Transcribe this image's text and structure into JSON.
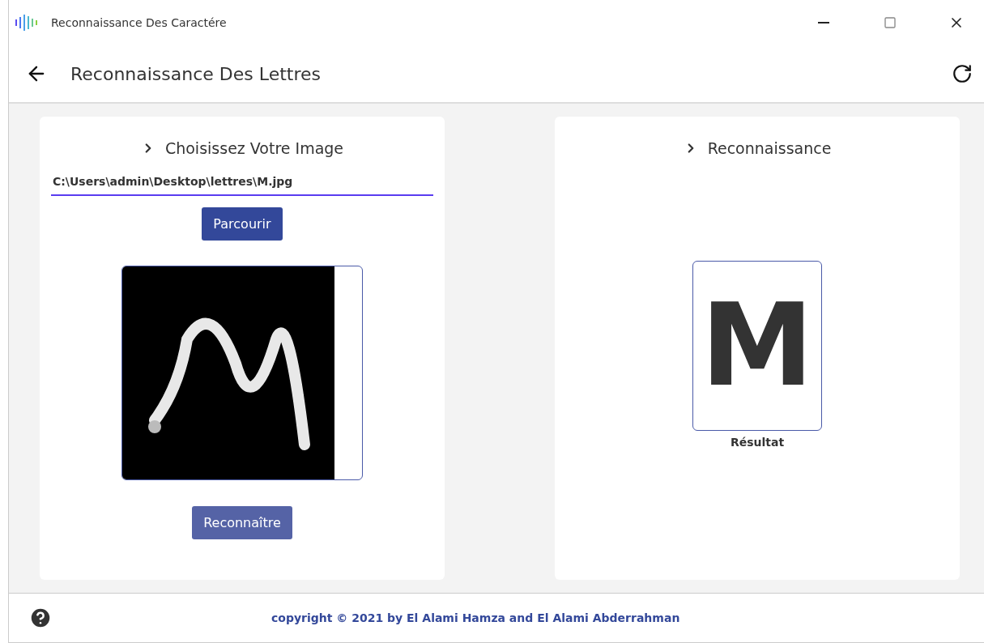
{
  "window": {
    "title": "Reconnaissance Des Caractére"
  },
  "header": {
    "title": "Reconnaissance Des Lettres"
  },
  "input_card": {
    "title": "Choisissez Votre Image",
    "path_field": {
      "value": "C:\\Users\\admin\\Desktop\\lettres\\M.jpg"
    },
    "browse_button": "Parcourir",
    "recognize_button": "Reconnaître"
  },
  "result_card": {
    "title": "Reconnaissance",
    "letter": "M",
    "caption": "Résultat"
  },
  "footer": {
    "copyright": "copyright © 2021 by El Alami Hamza and El Alami Abderrahman"
  }
}
